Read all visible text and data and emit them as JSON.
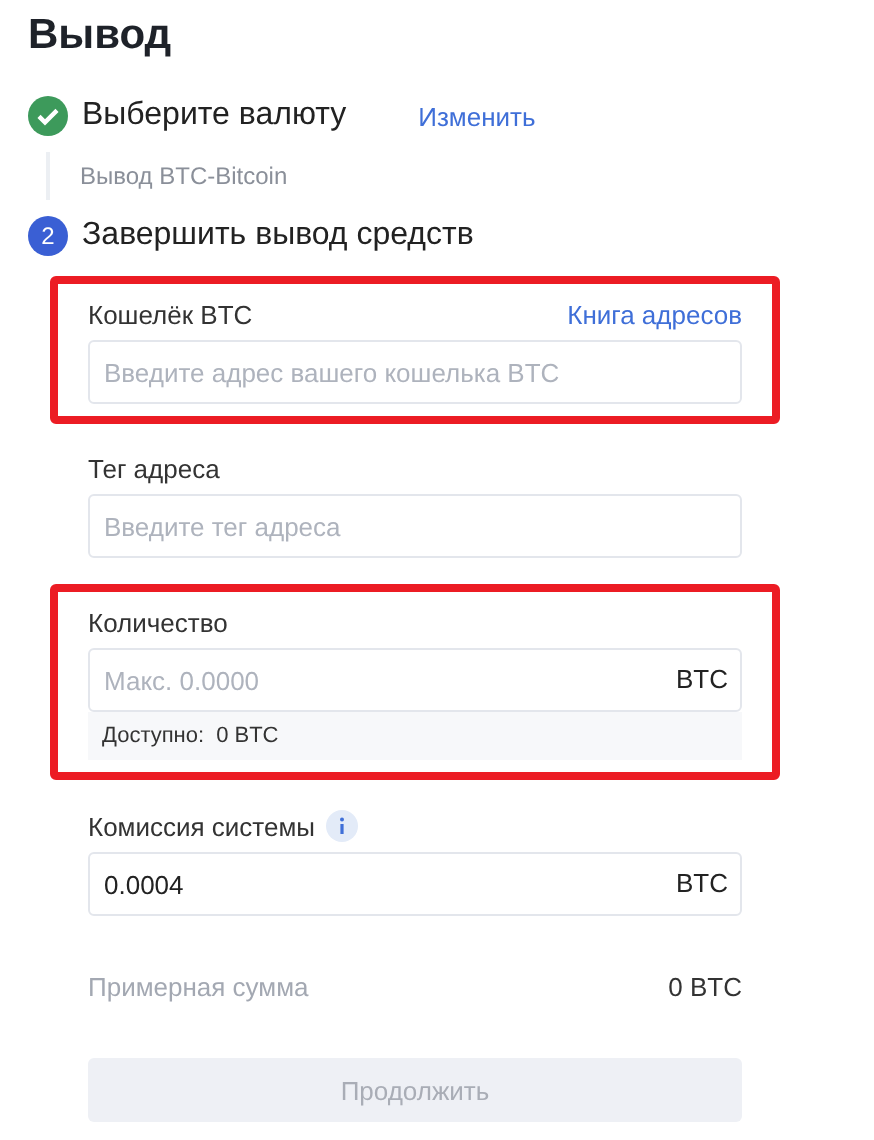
{
  "title": "Вывод",
  "steps": [
    {
      "completed": true,
      "label": "Выберите валюту",
      "link": "Изменить",
      "detail": "Вывод BTC-Bitcoin"
    },
    {
      "completed": false,
      "number": "2",
      "label": "Завершить вывод средств"
    }
  ],
  "fields": [
    {
      "label": "Кошелёк BTC",
      "link": "Книга адресов",
      "placeholder": "Введите адрес вашего кошелька BTC",
      "highlighted": true
    },
    {
      "label": "Тег адреса",
      "placeholder": "Введите тег адреса",
      "highlighted": false
    },
    {
      "label": "Количество",
      "placeholder": "Макс. 0.0000",
      "suffix": "BTC",
      "note_label": "Доступно:",
      "note_value": "0 BTC",
      "highlighted": true
    },
    {
      "label": "Комиссия системы",
      "info": true,
      "value": "0.0004",
      "suffix": "BTC",
      "highlighted": false
    }
  ],
  "estimate": {
    "label": "Примерная сумма",
    "value": "0 BTC"
  },
  "continue_button": {
    "label": "Продолжить",
    "disabled": true
  }
}
